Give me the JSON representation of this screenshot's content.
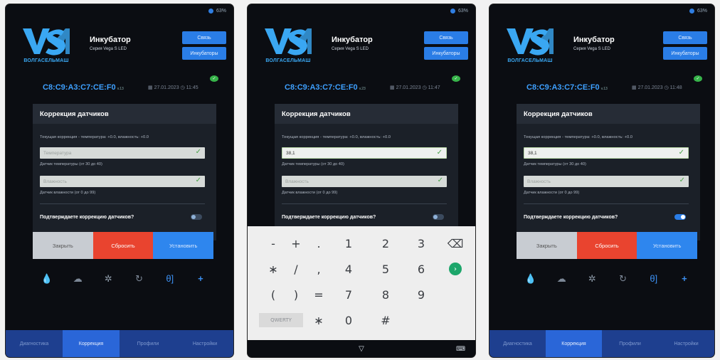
{
  "status": {
    "battery": "63%",
    "battery_p2": "63%",
    "battery_p3": "63%"
  },
  "brand": {
    "logo_text": "ВОЛГАСЕЛЬМАШ",
    "app_title": "Инкубатор",
    "app_subtitle": "Серия Vega S LED"
  },
  "header": {
    "button_link": "Связь",
    "button_incubators": "Инкубаторы",
    "mac": "C8:C9:A3:C7:CE:F0",
    "mac_suffix_p1": "v.13",
    "mac_suffix_p2": "v.23",
    "mac_suffix_p3": "v.13",
    "date": "27.01.2023",
    "time_p1": "11:45",
    "time_p2": "11:47",
    "time_p3": "11:48"
  },
  "card": {
    "title": "Коррекция датчиков",
    "current": "Текущая коррекция - температура: +0.0, влажность: +0.0",
    "temp_placeholder": "Температура",
    "temp_value": "38,1",
    "temp_hint": "Датчик температуры (от 30 до 40)",
    "hum_placeholder": "Влажность",
    "hum_hint": "Датчик влажности (от 0 до 99)",
    "confirm": "Подтверждаете коррекцию датчиков?"
  },
  "actions": {
    "close": "Закрыть",
    "reset": "Сбросить",
    "set": "Установить"
  },
  "tabs": {
    "diagnostics": "Диагностика",
    "correction": "Коррекция",
    "profiles": "Профили",
    "settings": "Настройки"
  },
  "keyboard": {
    "rows": [
      [
        "-",
        "+",
        ".",
        "1",
        "2",
        "3",
        "⌫"
      ],
      [
        "∗",
        "/",
        ",",
        "4",
        "5",
        "6",
        "›"
      ],
      [
        "(",
        ")",
        "=",
        "7",
        "8",
        "9",
        ""
      ],
      [
        "QWERTY",
        "",
        "∗",
        "0",
        "#",
        "",
        ""
      ]
    ]
  },
  "icons": [
    "water-drop-icon",
    "cloud-rain-icon",
    "fan-icon",
    "cycle-icon",
    "egg-turn-icon",
    "plus-icon"
  ],
  "colors": {
    "accent": "#2a7de6",
    "reset": "#e9442f",
    "tab_bar": "#1e3f8f"
  }
}
